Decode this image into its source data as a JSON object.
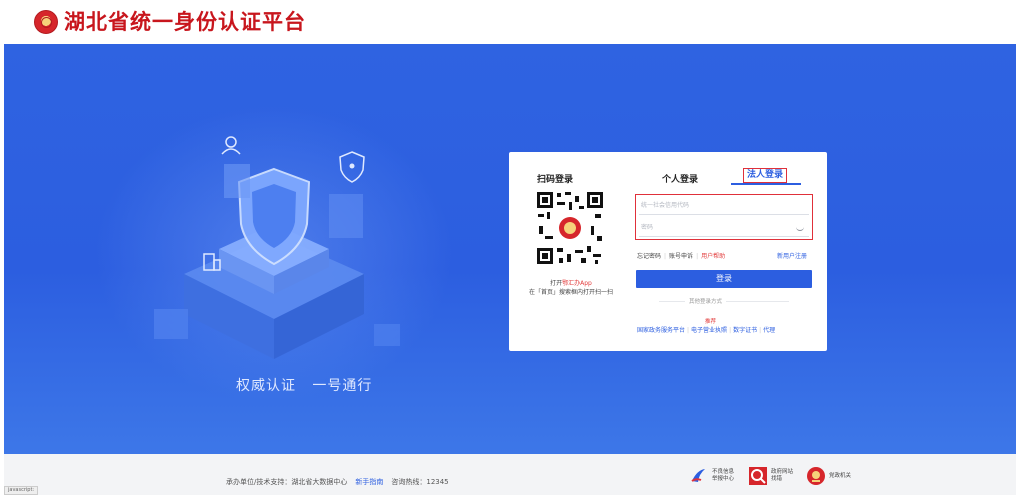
{
  "header": {
    "title": "湖北省统一身份认证平台"
  },
  "hero": {
    "slogan": "权威认证   一号通行"
  },
  "login": {
    "qr_tab": "扫码登录",
    "qr_open_prefix": "打开",
    "qr_open_app": "鄂汇办App",
    "qr_hint": "在「首页」搜索框内打开扫一扫",
    "tab_personal": "个人登录",
    "tab_legal": "法人登录",
    "code_placeholder": "统一社会信用代码",
    "password_placeholder": "密码",
    "forgot_password": "忘记密码",
    "account_appeal": "账号申诉",
    "user_help": "用户帮助",
    "register": "新用户注册",
    "login_button": "登录",
    "other_methods": "其他登录方式",
    "recommend": "推荐",
    "alt_methods": [
      "国家政务服务平台",
      "电子营业执照",
      "数字证书",
      "代理"
    ]
  },
  "footer": {
    "support": "承办单位/技术支持：湖北省大数据中心",
    "guide": "新手指南",
    "hotline": "咨询热线：12345",
    "badges": [
      {
        "label": "不良信息\n举报中心",
        "icon": "report-center-icon"
      },
      {
        "label": "政府网站\n找错",
        "icon": "gov-site-error-icon"
      },
      {
        "label": "党政机关",
        "icon": "party-gov-organ-icon"
      }
    ],
    "status": "javascript:"
  },
  "colors": {
    "brand_red": "#c8161d",
    "primary_blue": "#2c5ee0",
    "highlight_red": "#e0303a"
  }
}
